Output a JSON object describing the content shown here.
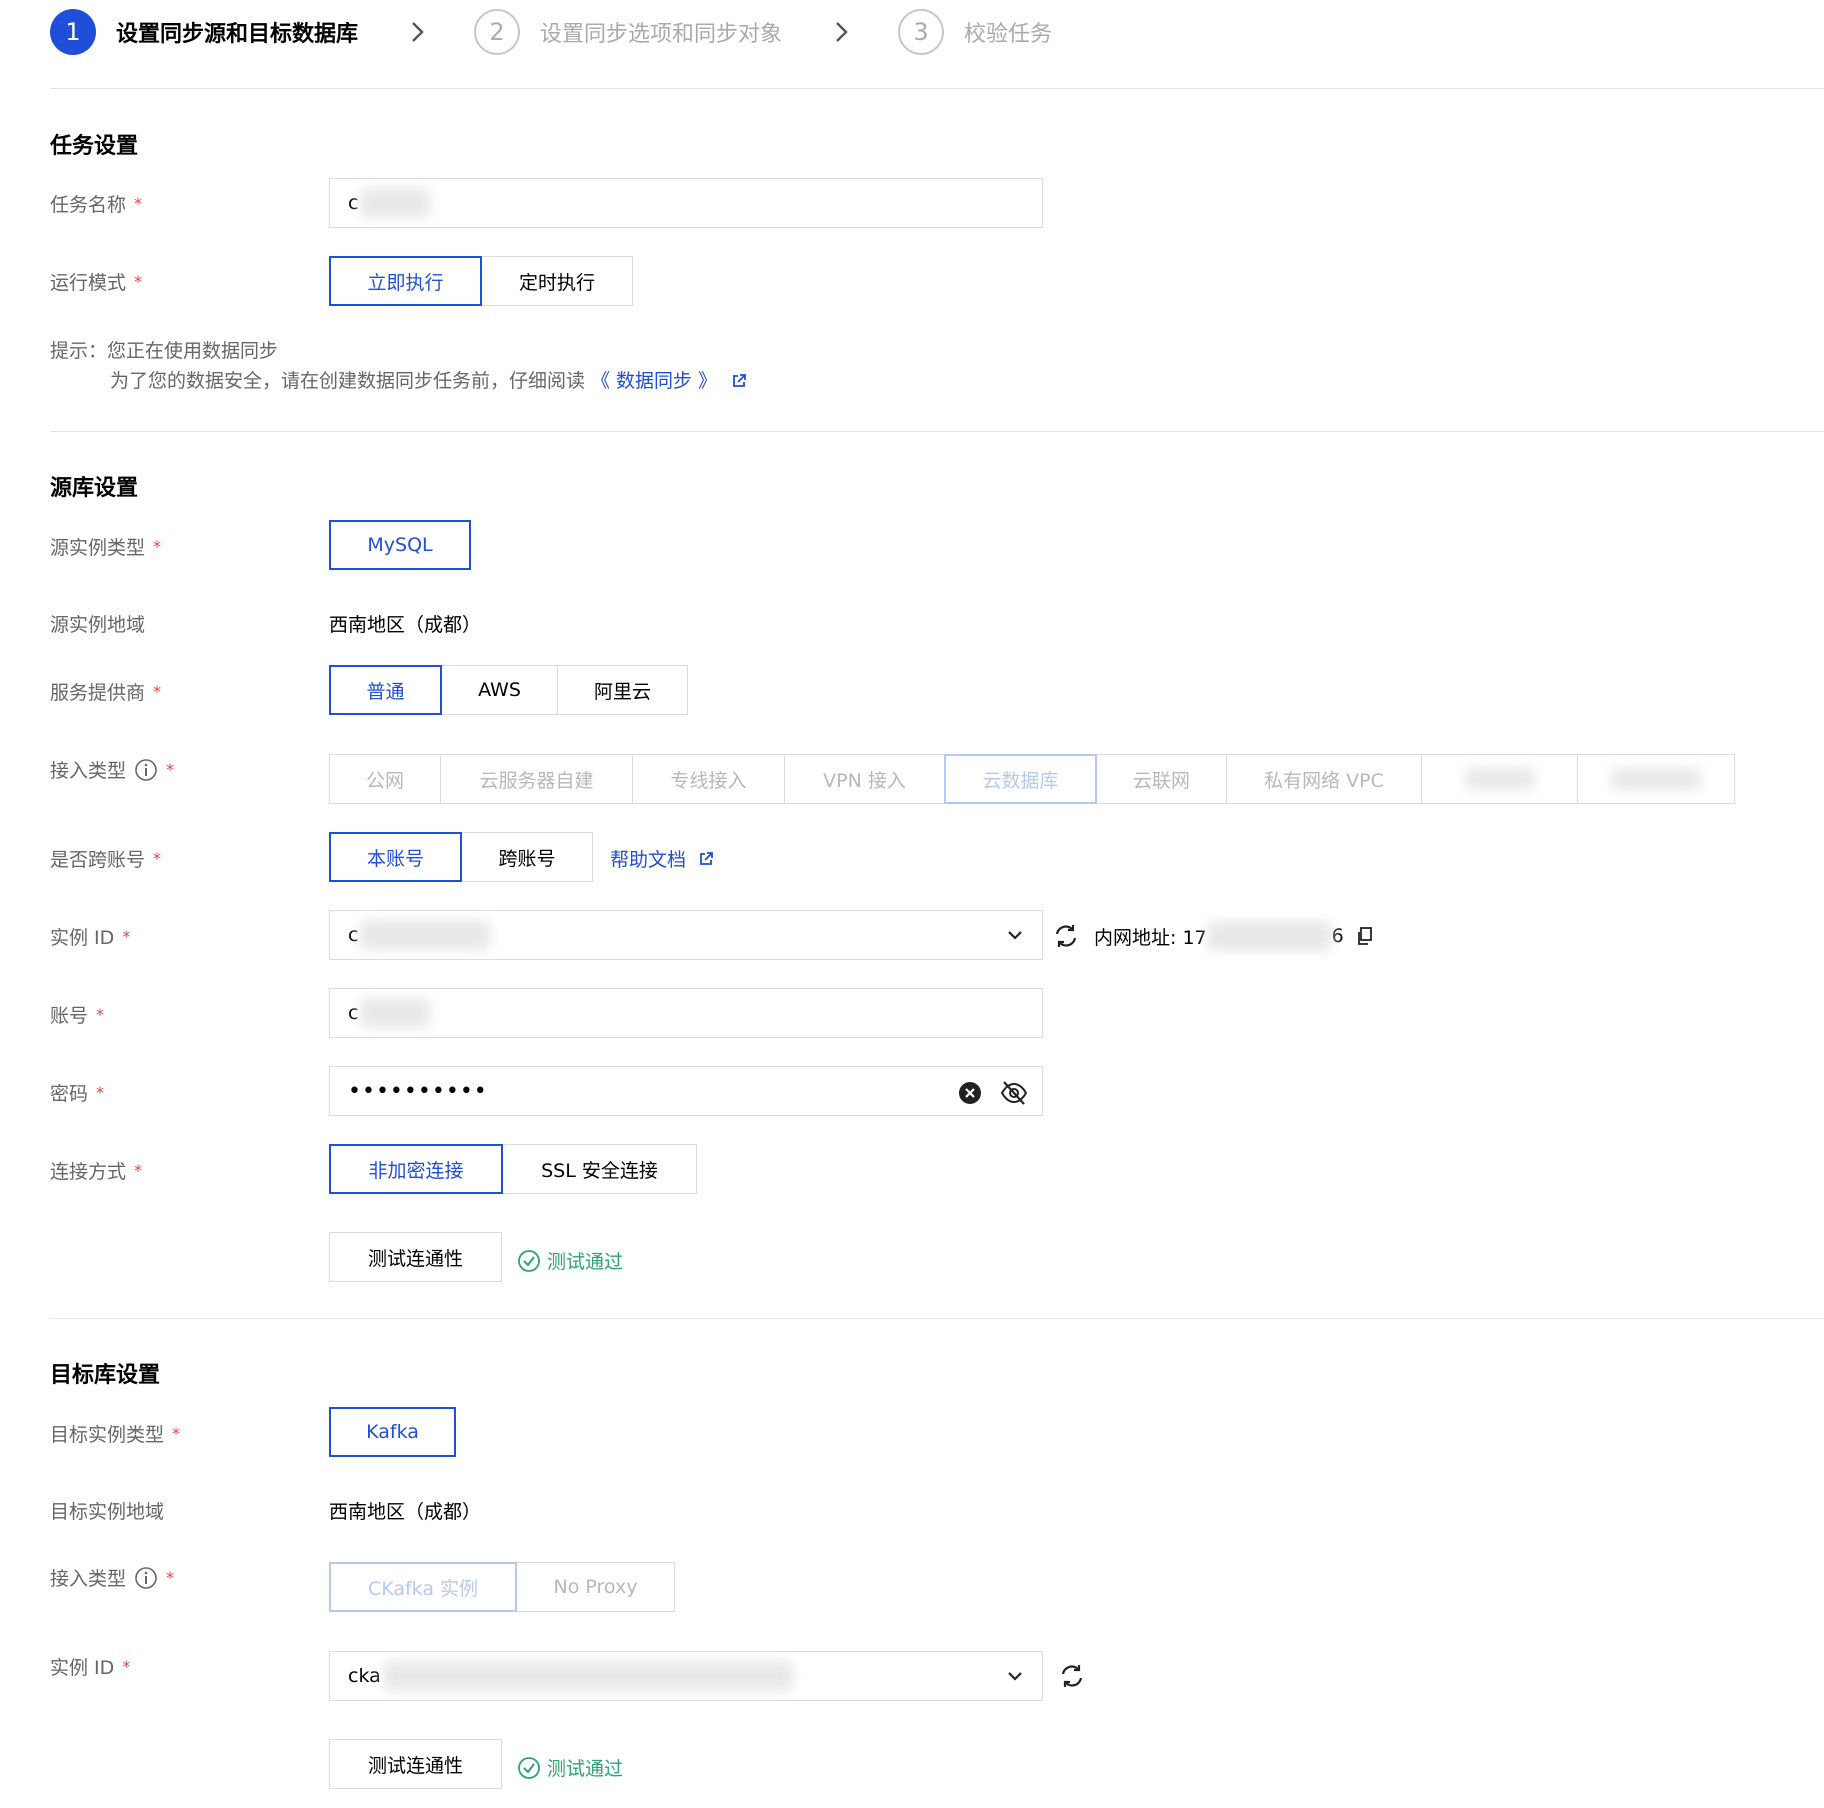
{
  "steps": [
    {
      "num": "1",
      "label": "设置同步源和目标数据库"
    },
    {
      "num": "2",
      "label": "设置同步选项和同步对象"
    },
    {
      "num": "3",
      "label": "校验任务"
    }
  ],
  "task": {
    "title": "任务设置",
    "name_label": "任务名称",
    "name_value": "c",
    "mode_label": "运行模式",
    "mode_options": [
      "立即执行",
      "定时执行"
    ],
    "hint_line1": "提示：您正在使用数据同步",
    "hint_line2": "为了您的数据安全，请在创建数据同步任务前，仔细阅读",
    "hint_link": "《 数据同步 》"
  },
  "source": {
    "title": "源库设置",
    "type_label": "源实例类型",
    "type_value": "MySQL",
    "region_label": "源实例地域",
    "region_value": "西南地区（成都）",
    "provider_label": "服务提供商",
    "provider_options": [
      "普通",
      "AWS",
      "阿里云"
    ],
    "access_label": "接入类型",
    "access_options": [
      "公网",
      "云服务器自建",
      "专线接入",
      "VPN 接入",
      "云数据库",
      "云联网",
      "私有网络 VPC"
    ],
    "cross_label": "是否跨账号",
    "cross_options": [
      "本账号",
      "跨账号"
    ],
    "help_link": "帮助文档",
    "instance_label": "实例 ID",
    "instance_value": "c",
    "intranet_prefix": "内网地址: 17",
    "intranet_suffix": "6",
    "account_label": "账号",
    "account_value": "c",
    "password_label": "密码",
    "password_value": "••••••••••",
    "conn_label": "连接方式",
    "conn_options": [
      "非加密连接",
      "SSL 安全连接"
    ],
    "test_button": "测试连通性",
    "test_result": "测试通过"
  },
  "target": {
    "title": "目标库设置",
    "type_label": "目标实例类型",
    "type_value": "Kafka",
    "region_label": "目标实例地域",
    "region_value": "西南地区（成都）",
    "access_label": "接入类型",
    "access_options": [
      "CKafka 实例",
      "No Proxy"
    ],
    "instance_label": "实例 ID",
    "instance_value": "cka",
    "test_button": "测试连通性",
    "test_result": "测试通过"
  },
  "colors": {
    "accent": "#1f4fd8",
    "required": "#e54545",
    "success": "#2ba471"
  }
}
